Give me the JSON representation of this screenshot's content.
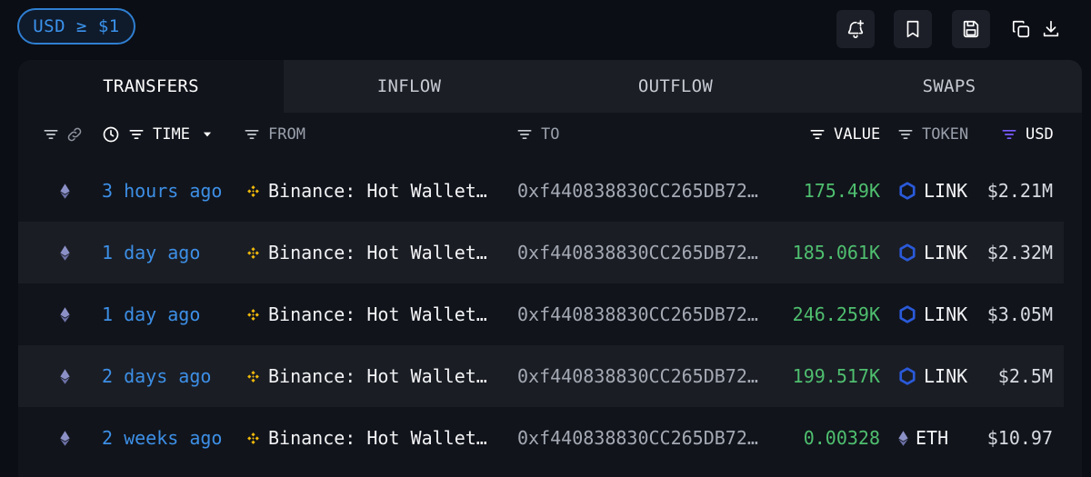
{
  "filter": {
    "label": "USD ≥ $1"
  },
  "toolbar": {
    "icons": [
      "bell-plus-icon",
      "bookmark-icon",
      "save-icon",
      "copy-icon",
      "download-icon"
    ]
  },
  "tabs": [
    {
      "label": "TRANSFERS",
      "active": true
    },
    {
      "label": "INFLOW",
      "active": false
    },
    {
      "label": "OUTFLOW",
      "active": false
    },
    {
      "label": "SWAPS",
      "active": false
    }
  ],
  "columns": {
    "time": "TIME",
    "from": "FROM",
    "to": "TO",
    "value": "VALUE",
    "token": "TOKEN",
    "usd": "USD"
  },
  "rows": [
    {
      "chain": "ethereum",
      "time": "3 hours ago",
      "from": "Binance: Hot Wallet…",
      "to": "0xf440838830CC265DB72…",
      "value": "175.49K",
      "token": "LINK",
      "usd": "$2.21M"
    },
    {
      "chain": "ethereum",
      "time": "1 day ago",
      "from": "Binance: Hot Wallet…",
      "to": "0xf440838830CC265DB72…",
      "value": "185.061K",
      "token": "LINK",
      "usd": "$2.32M"
    },
    {
      "chain": "ethereum",
      "time": "1 day ago",
      "from": "Binance: Hot Wallet…",
      "to": "0xf440838830CC265DB72…",
      "value": "246.259K",
      "token": "LINK",
      "usd": "$3.05M"
    },
    {
      "chain": "ethereum",
      "time": "2 days ago",
      "from": "Binance: Hot Wallet…",
      "to": "0xf440838830CC265DB72…",
      "value": "199.517K",
      "token": "LINK",
      "usd": "$2.5M"
    },
    {
      "chain": "ethereum",
      "time": "2 weeks ago",
      "from": "Binance: Hot Wallet…",
      "to": "0xf440838830CC265DB72…",
      "value": "0.00328",
      "token": "ETH",
      "usd": "$10.97"
    }
  ],
  "colors": {
    "accent": "#3b93ec",
    "value_green": "#4fbf6f",
    "binance_yellow": "#f0b90b",
    "chainlink_blue": "#2a5ada",
    "usd_filter_purple": "#7b5cff"
  }
}
